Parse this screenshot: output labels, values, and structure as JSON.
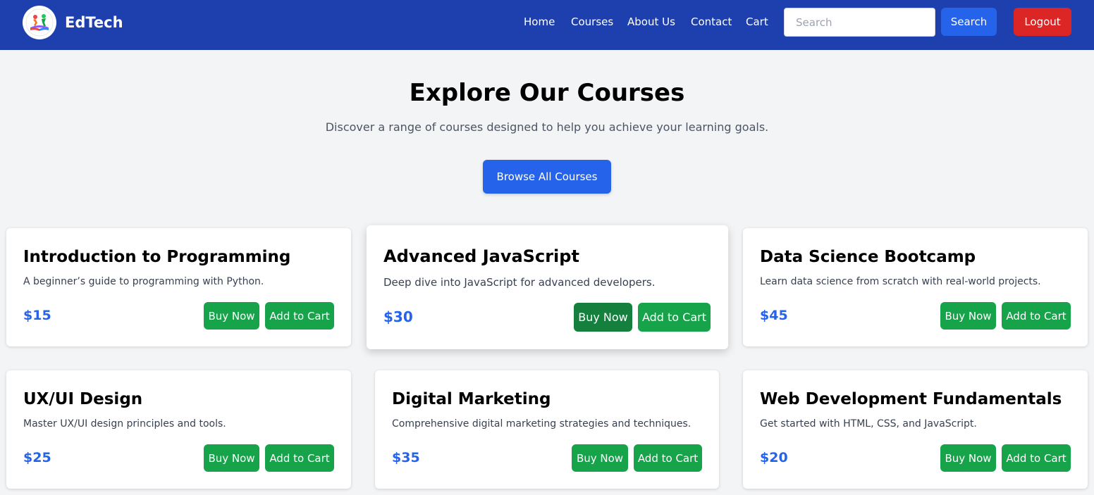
{
  "nav": {
    "brand": "EdTech",
    "links": [
      "Home",
      "Courses",
      "About Us",
      "Contact",
      "Cart"
    ],
    "search_placeholder": "Search",
    "search_button": "Search",
    "logout_button": "Logout"
  },
  "hero": {
    "title": "Explore Our Courses",
    "subtitle": "Discover a range of courses designed to help you achieve your learning goals.",
    "browse_button": "Browse All Courses"
  },
  "courses": [
    {
      "title": "Introduction to Programming",
      "description": "A beginner’s guide to programming with Python.",
      "price": "$15",
      "buy": "Buy Now",
      "cart": "Add to Cart"
    },
    {
      "title": "Advanced JavaScript",
      "description": "Deep dive into JavaScript for advanced developers.",
      "price": "$30",
      "buy": "Buy Now",
      "cart": "Add to Cart"
    },
    {
      "title": "Data Science Bootcamp",
      "description": "Learn data science from scratch with real-world projects.",
      "price": "$45",
      "buy": "Buy Now",
      "cart": "Add to Cart"
    },
    {
      "title": "UX/UI Design",
      "description": "Master UX/UI design principles and tools.",
      "price": "$25",
      "buy": "Buy Now",
      "cart": "Add to Cart"
    },
    {
      "title": "Digital Marketing",
      "description": "Comprehensive digital marketing strategies and techniques.",
      "price": "$35",
      "buy": "Buy Now",
      "cart": "Add to Cart"
    },
    {
      "title": "Web Development Fundamentals",
      "description": "Get started with HTML, CSS, and JavaScript.",
      "price": "$20",
      "buy": "Buy Now",
      "cart": "Add to Cart"
    }
  ],
  "colors": {
    "navbar": "#1e40af",
    "primary": "#2563eb",
    "danger": "#dc2626",
    "success": "#16a34a",
    "background": "#f3f4f6"
  }
}
